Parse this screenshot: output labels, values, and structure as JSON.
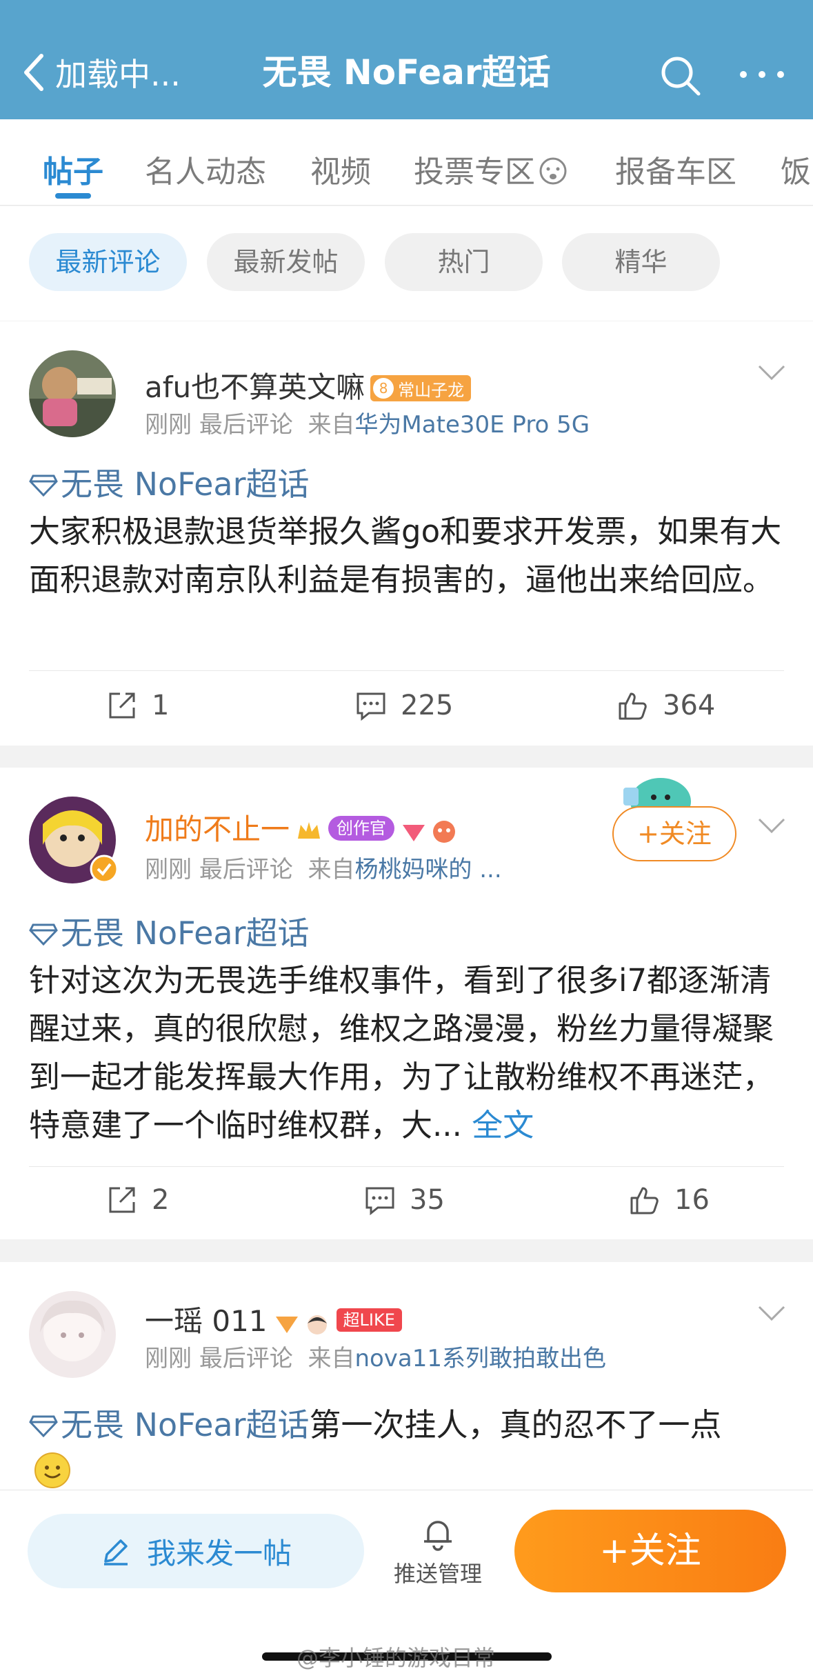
{
  "header": {
    "back_label": "加载中...",
    "title": "无畏 NoFear超话",
    "search_icon": "search-icon",
    "more_icon": "more-icon"
  },
  "tabs": [
    {
      "label": "帖子",
      "active": true
    },
    {
      "label": "名人动态",
      "active": false
    },
    {
      "label": "视频",
      "active": false
    },
    {
      "label": "投票专区",
      "active": false
    },
    {
      "label": "报备车区",
      "active": false
    },
    {
      "label": "饭",
      "active": false
    }
  ],
  "filters": [
    {
      "label": "最新评论",
      "active": true
    },
    {
      "label": "最新发帖",
      "active": false
    },
    {
      "label": "热门",
      "active": false
    },
    {
      "label": "精华",
      "active": false
    }
  ],
  "posts": [
    {
      "username": "afu也不算英文嘛",
      "level": "8",
      "level_title": "常山子龙",
      "time": "刚刚",
      "tag": "最后评论",
      "source_prefix": "来自",
      "source": "华为Mate30E Pro 5G",
      "topic": "无畏 NoFear超话",
      "text": "大家积极退款退货举报久酱go和要求开发票，如果有大面积退款对南京队利益是有损害的，逼他出来给回应。",
      "reposts": "1",
      "comments": "225",
      "likes": "364"
    },
    {
      "username": "加的不止一",
      "creator_badge": "创作官",
      "time": "刚刚",
      "tag": "最后评论",
      "source_prefix": "来自",
      "source": "杨桃妈咪的 ...",
      "follow_label": "+关注",
      "topic": "无畏 NoFear超话",
      "text": "针对这次为无畏选手维权事件，看到了很多i7都逐渐清醒过来，真的很欣慰，维权之路漫漫，粉丝力量得凝聚到一起才能发挥最大作用，为了让散粉维权不再迷茫，特意建了一个临时维权群，大...",
      "more_label": "全文",
      "reposts": "2",
      "comments": "35",
      "likes": "16"
    },
    {
      "username": "一瑶 011",
      "superlike": "超LIKE",
      "time": "刚刚",
      "tag": "最后评论",
      "source_prefix": "来自",
      "source": "nova11系列敢拍敢出色",
      "topic": "无畏 NoFear超话",
      "text": "第一次挂人，真的忍不了一点"
    }
  ],
  "bottom": {
    "post_label": "我来发一帖",
    "push_label": "推送管理",
    "follow_label": "+关注"
  },
  "watermark": "@李小锤的游戏日常",
  "colors": {
    "header": "#58a4cd",
    "accent": "#2b8ad2",
    "orange": "#f97d13",
    "topic": "#4a78a5"
  }
}
